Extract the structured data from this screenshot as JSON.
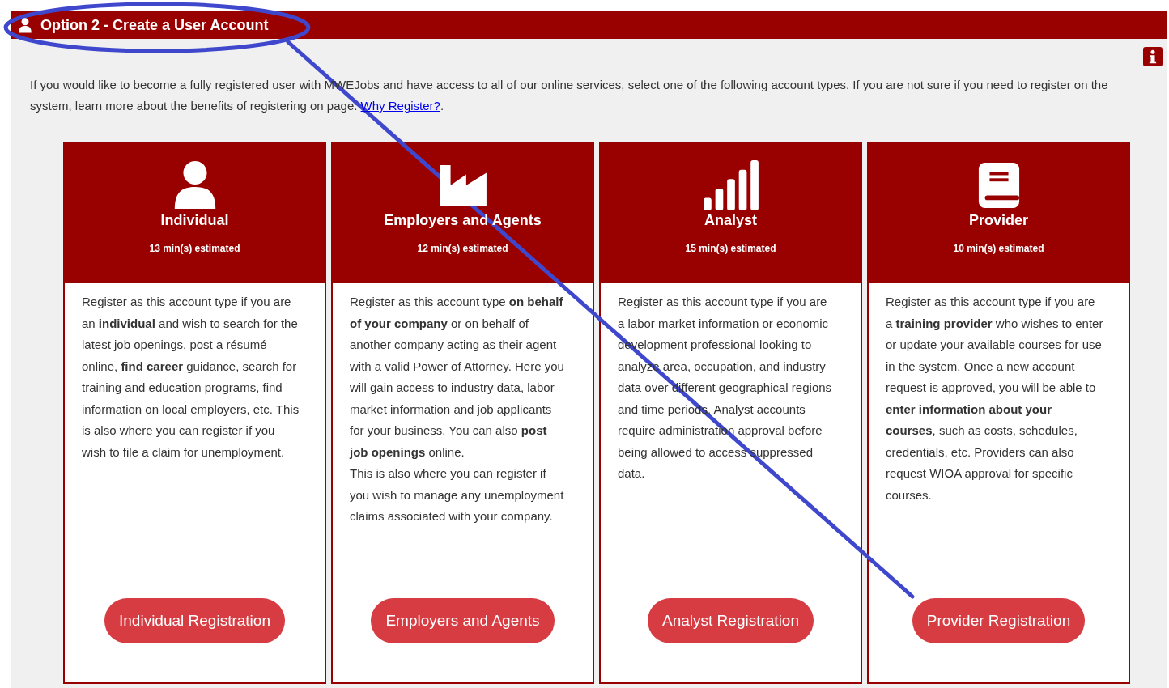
{
  "section": {
    "title": "Option 2 - Create a User Account"
  },
  "intro": {
    "text": "If you would like to become a fully registered user with MWEJobs and have access to all of our online services, select one of the following account types. If you are not sure if you need to register on the system, learn more about the benefits of registering on page: ",
    "link": "Why Register?",
    "after": "."
  },
  "cards": [
    {
      "kind": "person",
      "title": "Individual",
      "estimate": "13 min(s) estimated",
      "description": [
        "Register as this account type if you are an **individual** and wish to search for the latest job openings, post a résumé online, **find career** guidance, search for training and education programs, find information on local employers, etc. This is also where you can register if you wish to file a claim for unemployment."
      ],
      "button": "Individual Registration"
    },
    {
      "kind": "factory",
      "title": "Employers and Agents",
      "estimate": "12 min(s) estimated",
      "description": [
        "Register as this account type **on behalf of your company** or on behalf of another company acting as their agent with a valid Power of Attorney. Here you will gain access to industry data, labor market information and job applicants for your business. You can also **post job openings** online.",
        "This is also where you can register if you wish to manage any unemployment claims associated with your company."
      ],
      "button": "Employers and Agents"
    },
    {
      "kind": "chart",
      "title": "Analyst",
      "estimate": "15 min(s) estimated",
      "description": [
        "Register as this account type if you are a labor market information or economic development professional looking to analyze area, occupation, and industry data over different geographical regions and time periods. Analyst accounts require administration approval before being allowed to access suppressed data."
      ],
      "button": "Analyst Registration"
    },
    {
      "kind": "book",
      "title": "Provider",
      "estimate": "10 min(s) estimated",
      "description": [
        "Register as this account type if you are a **training provider** who wishes to enter or update your available courses for use in the system. Once a new account request is approved, you will be able to **enter information about your courses**, such as costs, schedules, credentials, etc. Providers can also request WIOA approval for specific courses."
      ],
      "button": "Provider Registration"
    }
  ]
}
